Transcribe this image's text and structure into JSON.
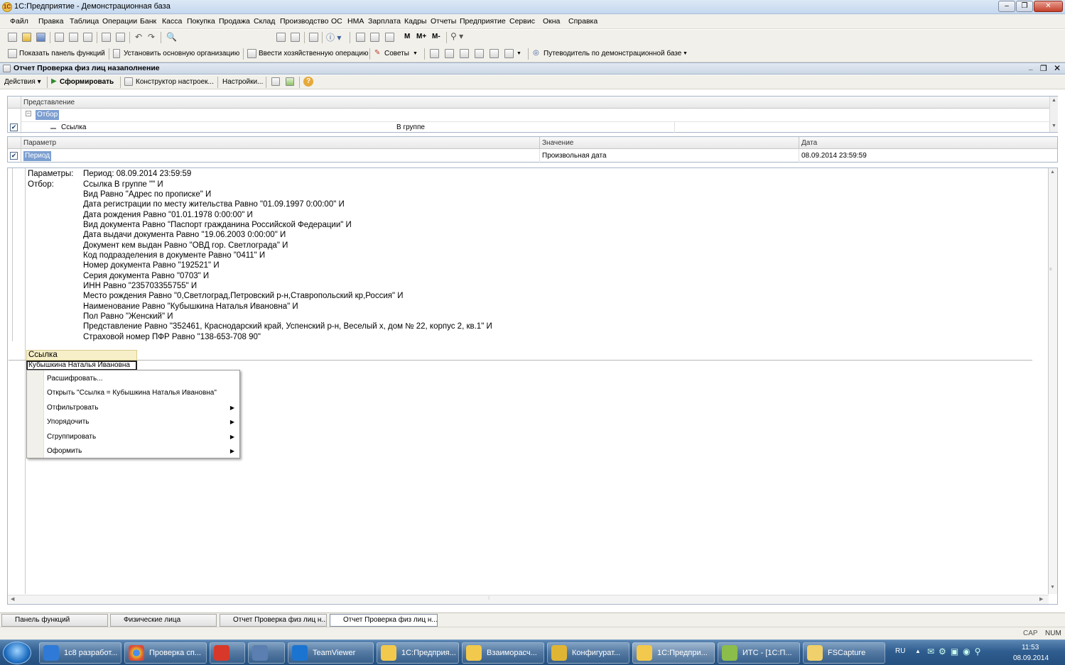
{
  "window": {
    "title": "1С:Предприятие - Демонстрационная база",
    "app_logo": "1С"
  },
  "menu": [
    "Файл",
    "Правка",
    "Таблица",
    "Операции",
    "Банк",
    "Касса",
    "Покупка",
    "Продажа",
    "Склад",
    "Производство",
    "ОС",
    "НМА",
    "Зарплата",
    "Кадры",
    "Отчеты",
    "Предприятие",
    "Сервис",
    "Окна",
    "Справка"
  ],
  "toolbar2": {
    "mem_buttons": [
      "M",
      "M+",
      "M-"
    ]
  },
  "toolbar3": {
    "show_panel": "Показать панель функций",
    "set_org": "Установить основную организацию",
    "enter_op": "Ввести хозяйственную операцию",
    "tips": "Советы",
    "guide": "Путеводитель по демонстрационной базе"
  },
  "document": {
    "title": "Отчет  Проверка физ лиц назаполнение",
    "actions_label": "Действия",
    "generate_label": "Сформировать",
    "constructor_label": "Конструктор настроек...",
    "settings_label": "Настройки..."
  },
  "filter_grid": {
    "header": "Представление",
    "group_label": "Отбор",
    "row_field": "Ссылка",
    "row_condition": "В группе"
  },
  "param_grid": {
    "headers": [
      "Параметр",
      "Значение",
      "Дата"
    ],
    "row": [
      "Период",
      "Произвольная дата",
      "08.09.2014 23:59:59"
    ]
  },
  "report": {
    "params_label": "Параметры:",
    "params_value": "Период: 08.09.2014 23:59:59",
    "filter_label": "Отбор:",
    "filter_lines": [
      "Ссылка В группе \"\" И",
      "Вид Равно \"Адрес по прописке\" И",
      "Дата регистрации по месту жительства Равно \"01.09.1997 0:00:00\" И",
      "Дата рождения Равно \"01.01.1978 0:00:00\" И",
      "Вид документа Равно \"Паспорт гражданина Российской Федерации\" И",
      "Дата выдачи документа Равно \"19.06.2003 0:00:00\" И",
      "Документ кем выдан Равно \"ОВД гор. Светлограда\" И",
      "Код подразделения в документе Равно \"0411\" И",
      "Номер документа Равно \"192521\" И",
      "Серия документа Равно \"0703\" И",
      "ИНН Равно \"235703355755\" И",
      "Место рождения Равно \"0,Светлоград,Петровский р-н,Ставропольский кр,Россия\" И",
      "Наименование Равно \"Кубышкина Наталья Ивановна\" И",
      "Пол Равно \"Женский\" И",
      "Представление Равно \"352461, Краснодарский край, Успенский р-н, Веселый х, дом № 22, корпус 2, кв.1\" И",
      "Страховой номер ПФР Равно \"138-653-708 90\""
    ],
    "column_header": "Ссылка",
    "cell_value": "Кубышкина Наталья Ивановна"
  },
  "context_menu": [
    {
      "label": "Расшифровать...",
      "submenu": false
    },
    {
      "label": "Открыть \"Ссылка = Кубышкина Наталья Ивановна\"",
      "submenu": false
    },
    {
      "label": "Отфильтровать",
      "submenu": true
    },
    {
      "label": "Упорядочить",
      "submenu": true
    },
    {
      "label": "Сгруппировать",
      "submenu": true
    },
    {
      "label": "Оформить",
      "submenu": true
    }
  ],
  "window_tabs": [
    "Панель функций",
    "Физические лица",
    "Отчет  Проверка физ лиц н...",
    "Отчет  Проверка физ лиц н..."
  ],
  "status": [
    "CAP",
    "NUM"
  ],
  "taskbar": {
    "items": [
      "1с8 разработ...",
      "Проверка сп...",
      "",
      "",
      "TeamViewer",
      "1С:Предприя...",
      "Взаиморасч...",
      "Конфигурат...",
      "1С:Предпри...",
      "ИТС - [1С:П...",
      "FSCapture"
    ],
    "lang": "RU",
    "time": "11:53",
    "date": "08.09.2014"
  },
  "colors": {
    "selection": "#7c9fd1",
    "accent": "#1f6fc2"
  }
}
